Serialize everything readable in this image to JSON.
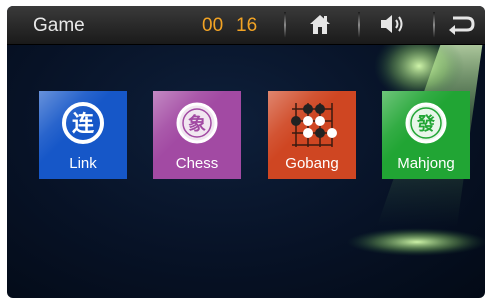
{
  "header": {
    "title": "Game",
    "clock_hours": "00",
    "clock_minutes": "16"
  },
  "toolbar": {
    "home_icon": "home-icon",
    "volume_icon": "volume-icon",
    "back_icon": "back-icon"
  },
  "games": [
    {
      "label": "Link",
      "glyph": "连",
      "color": "#1657c8",
      "icon": "link-emblem-icon"
    },
    {
      "label": "Chess",
      "glyph": "象",
      "color": "#a24aa3",
      "icon": "chess-emblem-icon"
    },
    {
      "label": "Gobang",
      "color": "#cf4622",
      "icon": "gobang-board-icon"
    },
    {
      "label": "Mahjong",
      "glyph": "發",
      "color": "#21a534",
      "icon": "mahjong-emblem-icon"
    }
  ],
  "colors": {
    "accent_time": "#f2a324",
    "background": "#071226"
  }
}
